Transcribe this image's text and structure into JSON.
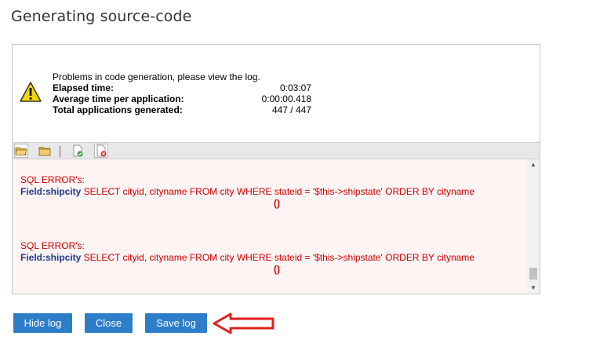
{
  "dialog": {
    "title": "Generating source-code"
  },
  "summary": {
    "message": "Problems in code generation, please view the log.",
    "stats": [
      {
        "label": "Elapsed time:",
        "value": "0:03:07"
      },
      {
        "label": "Average time per application:",
        "value": "0:00:00.418"
      },
      {
        "label": "Total applications generated:",
        "value": "447 / 447"
      }
    ],
    "icon": "warning-icon"
  },
  "toolbar": {
    "icons": [
      "folder-open-icon",
      "folder-icon",
      "document-check-icon",
      "document-error-icon"
    ]
  },
  "log": {
    "entries": [
      {
        "title": "SQL ERROR's:",
        "field": "Field:shipcity",
        "query": " SELECT cityid, cityname FROM city WHERE stateid = '$this->shipstate' ORDER BY cityname",
        "suffix": "()"
      },
      {
        "title": "SQL ERROR's:",
        "field": "Field:shipcity",
        "query": " SELECT cityid, cityname FROM city WHERE stateid = '$this->shipstate' ORDER BY cityname",
        "suffix": "()"
      }
    ]
  },
  "buttons": {
    "hide_log": "Hide log",
    "close": "Close",
    "save_log": "Save log"
  },
  "colors": {
    "accent": "#2d7ec9",
    "error": "#cc0000",
    "field": "#1a3b8c",
    "annotation_arrow": "#e02020"
  }
}
